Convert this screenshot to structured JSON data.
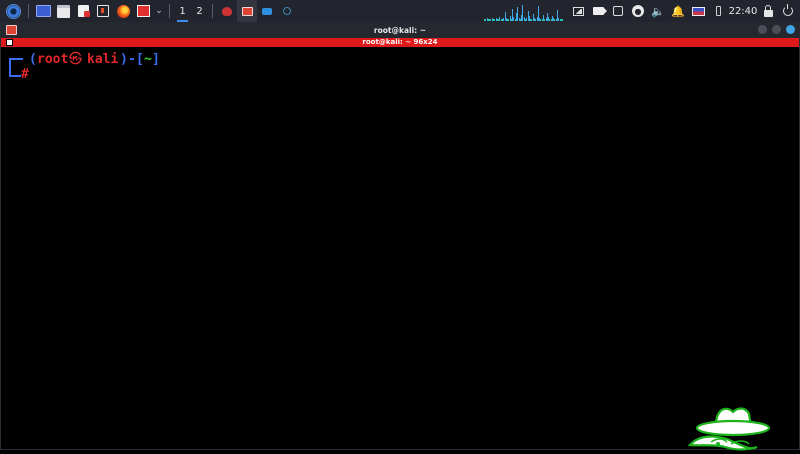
{
  "panel": {
    "workspaces": [
      "1",
      "2"
    ],
    "active_workspace": "1",
    "clock": "22:40",
    "icons": {
      "menu": "kali-menu-icon",
      "launchers": [
        "show-desktop-icon",
        "file-manager-icon",
        "text-editor-icon",
        "terminal-icon",
        "firefox-icon",
        "burpsuite-icon"
      ],
      "tray": [
        "network-icon",
        "camera-icon",
        "notes-icon",
        "vpn-icon",
        "volume-icon",
        "notification-bell-icon",
        "keyboard-layout-icon",
        "battery-icon",
        "lock-icon",
        "power-icon"
      ]
    }
  },
  "window": {
    "title": "root@kali: ~",
    "tab_label": "root@kali: ~ 96x24"
  },
  "terminal": {
    "open_paren": "(",
    "user": "root",
    "at_symbol": "㉿",
    "host": "kali",
    "close_paren": ")",
    "dash": "-",
    "open_bracket": "[",
    "cwd": "~",
    "close_bracket": "]",
    "prompt_char": "#"
  },
  "colors": {
    "panel_bg": "#23252e",
    "tab_bar": "#e01a1a",
    "prompt_blue": "#3b6ef0",
    "prompt_red": "#e02828",
    "prompt_green": "#2ed12e",
    "accent": "#3d8ef0"
  }
}
